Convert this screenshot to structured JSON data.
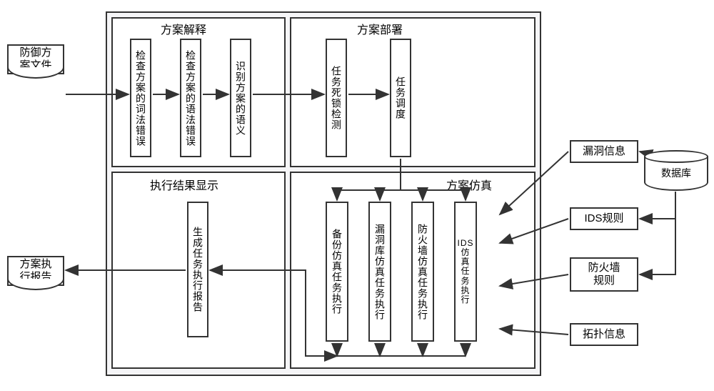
{
  "inputs": {
    "defense_file": "防御方\n案文件",
    "exec_report": "方案执\n行报告"
  },
  "sections": {
    "interpret": {
      "title": "方案解释",
      "steps": [
        "检查方案的词法错误",
        "检查方案的语法错误",
        "识别方案的语义"
      ]
    },
    "deploy": {
      "title": "方案部署",
      "steps": [
        "任务死锁检测",
        "任务调度"
      ]
    },
    "result": {
      "title": "执行结果显示",
      "steps": [
        "生成任务执行报告"
      ]
    },
    "sim": {
      "title": "方案仿真",
      "steps": [
        "备份仿真任务执行",
        "漏洞库仿真任务执行",
        "防火墙仿真任务执行",
        "IDS仿真任务执行"
      ]
    }
  },
  "right": {
    "db": "数据库",
    "info": [
      "漏洞信息",
      "IDS规则",
      "防火墙\n规则",
      "拓扑信息"
    ]
  }
}
